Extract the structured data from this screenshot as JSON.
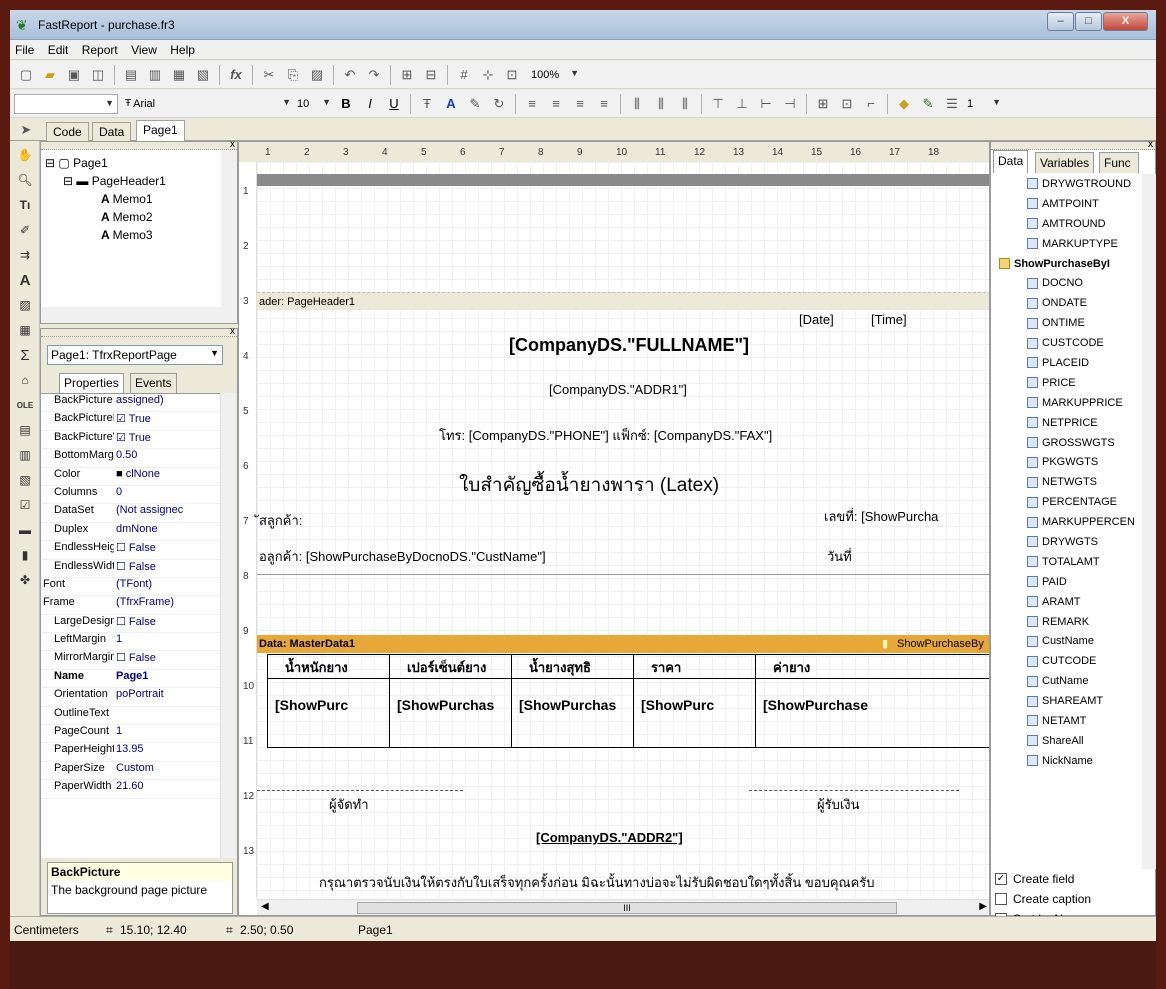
{
  "window": {
    "title": "FastReport - purchase.fr3",
    "minimize": "–",
    "maximize": "□",
    "close": "X"
  },
  "menu": [
    "File",
    "Edit",
    "Report",
    "View",
    "Help"
  ],
  "toolbar": {
    "zoom": "100%",
    "font_name": "Arial",
    "font_size": "10",
    "frame_width": "1"
  },
  "tabs": {
    "code": "Code",
    "data": "Data",
    "page": "Page1"
  },
  "tree": {
    "page": "Page1",
    "header": "PageHeader1",
    "memos": [
      "Memo1",
      "Memo2",
      "Memo3"
    ]
  },
  "props": {
    "selector": "Page1: TfrxReportPage",
    "tab_properties": "Properties",
    "tab_events": "Events",
    "rows": [
      {
        "name": "BackPicture",
        "value": "assigned)"
      },
      {
        "name": "BackPicturePr",
        "value": "True"
      },
      {
        "name": "BackPictureVi",
        "value": "True"
      },
      {
        "name": "BottomMargir",
        "value": "0.50"
      },
      {
        "name": "Color",
        "value": "clNone"
      },
      {
        "name": "Columns",
        "value": "0"
      },
      {
        "name": "DataSet",
        "value": "(Not assignec"
      },
      {
        "name": "Duplex",
        "value": "dmNone"
      },
      {
        "name": "EndlessHeigh",
        "value": "False"
      },
      {
        "name": "EndlessWidth",
        "value": "False"
      },
      {
        "name": "Font",
        "value": "(TFont)"
      },
      {
        "name": "Frame",
        "value": "(TfrxFrame)"
      },
      {
        "name": "LargeDesignH",
        "value": "False"
      },
      {
        "name": "LeftMargin",
        "value": "1"
      },
      {
        "name": "MirrorMargins",
        "value": "False"
      },
      {
        "name": "Name",
        "value": "Page1"
      },
      {
        "name": "Orientation",
        "value": "poPortrait"
      },
      {
        "name": "OutlineText",
        "value": ""
      },
      {
        "name": "PageCount",
        "value": "1"
      },
      {
        "name": "PaperHeight",
        "value": "13.95"
      },
      {
        "name": "PaperSize",
        "value": "Custom"
      },
      {
        "name": "PaperWidth",
        "value": "21.60"
      }
    ],
    "desc_title": "BackPicture",
    "desc_text": "The background page picture"
  },
  "ruler_nums": [
    "1",
    "2",
    "3",
    "4",
    "5",
    "6",
    "7",
    "8",
    "9",
    "10",
    "11",
    "12",
    "13",
    "14",
    "15",
    "16",
    "17",
    "18"
  ],
  "vruler_nums": [
    "1",
    "2",
    "3",
    "4",
    "5",
    "6",
    "7",
    "8",
    "9",
    "10",
    "11",
    "12",
    "13"
  ],
  "design": {
    "header_band": "ader: PageHeader1",
    "date": "[Date]",
    "time": "[Time]",
    "fullname": "[CompanyDS.\"FULLNAME\"]",
    "addr1": "[CompanyDS.\"ADDR1\"]",
    "phone": "โทร: [CompanyDS.\"PHONE\"] แฟ็กซ์: [CompanyDS.\"FAX\"]",
    "doc_title": "ใบสำคัญซื้อน้ำยางพารา (Latex)",
    "cust_code": "ัสลูกค้า:",
    "docno": "เลขที่: [ShowPurcha",
    "cust_name": "อลูกค้า: [ShowPurchaseByDocnoDS.\"CustName\"]",
    "date_label": "วันที่",
    "data_band": "Data: MasterData1",
    "data_band_ds": "ShowPurchaseBy",
    "col_headers": [
      "น้ำหนักยาง",
      "เปอร์เซ็นต์ยาง",
      "น้ำยางสุทธิ",
      "ราคา",
      "ค่ายาง"
    ],
    "col_values": [
      "[ShowPurc",
      "[ShowPurchas",
      "[ShowPurchas",
      "[ShowPurc",
      "[ShowPurchase"
    ],
    "payer": "ผู้จัดทำ",
    "receiver": "ผู้รับเงิน",
    "addr2": "[CompanyDS.\"ADDR2\"]",
    "footer_note": "กรุณาตรวจนับเงินให้ตรงกับใบเสร็จทุกครั้งก่อน  มิฉะนั้นทางบ่อจะไม่รับผิดชอบใดๆทั้งสิ้น ขอบคุณครับ",
    "hscroll": "III"
  },
  "datapanel": {
    "tabs": [
      "Data",
      "Variables",
      "Func"
    ],
    "fields_top": [
      "DRYWGTROUND",
      "AMTPOINT",
      "AMTROUND",
      "MARKUPTYPE"
    ],
    "ds_name": "ShowPurchaseByI",
    "fields": [
      "DOCNO",
      "ONDATE",
      "ONTIME",
      "CUSTCODE",
      "PLACEID",
      "PRICE",
      "MARKUPPRICE",
      "NETPRICE",
      "GROSSWGTS",
      "PKGWGTS",
      "NETWGTS",
      "PERCENTAGE",
      "MARKUPPERCEN",
      "DRYWGTS",
      "TOTALAMT",
      "PAID",
      "ARAMT",
      "REMARK",
      "CustName",
      "CUTCODE",
      "CutName",
      "SHAREAMT",
      "NETAMT",
      "ShareAll",
      "NickName"
    ],
    "create_field": "Create field",
    "create_caption": "Create caption",
    "sort_by_name": "Sort by Name"
  },
  "status": {
    "units": "Centimeters",
    "pos": "15.10; 12.40",
    "size": "2.50; 0.50",
    "page": "Page1"
  }
}
